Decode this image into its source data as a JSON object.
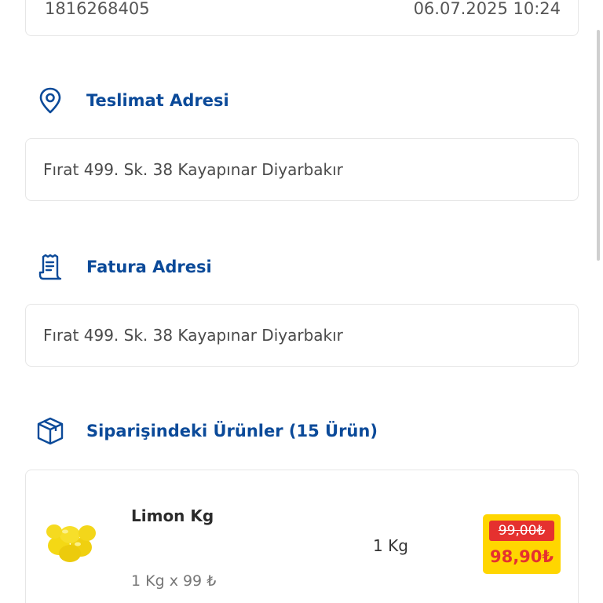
{
  "order": {
    "number": "1816268405",
    "date": "06.07.2025 10:24"
  },
  "delivery": {
    "icon": "location-pin-icon",
    "title": "Teslimat Adresi",
    "address": "Fırat 499. Sk. 38 Kayapınar Diyarbakır"
  },
  "invoice": {
    "icon": "receipt-icon",
    "title": "Fatura Adresi",
    "address": "Fırat 499. Sk. 38 Kayapınar Diyarbakır"
  },
  "products": {
    "icon": "package-box-icon",
    "title": "Siparişindeki Ürünler (15 Ürün)",
    "items": [
      {
        "name": "Limon Kg",
        "quantity": "1 Kg",
        "unit_price": "1 Kg x 99 ₺",
        "old_price": "99,00₺",
        "new_price": "98,90₺"
      }
    ]
  },
  "colors": {
    "accent": "#0b4a99",
    "price_badge": "#ffd600",
    "discount_red": "#e5312f"
  }
}
